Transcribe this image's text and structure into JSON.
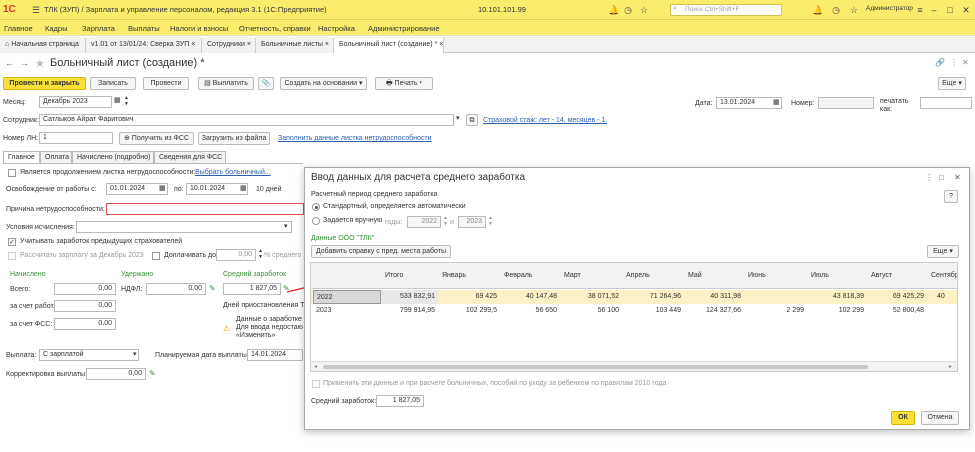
{
  "app": {
    "title": "ТЛК (ЗУП) / Зарплата и управление персоналом, редакция 3.1  (1С:Предприятие)",
    "ip": "10.101.101.99",
    "search_placeholder": "Поиск Ctrl+Shift+F",
    "user": "Администратор",
    "logo": "1С"
  },
  "menu": [
    "Главное",
    "Кадры",
    "Зарплата",
    "Выплаты",
    "Налоги и взносы",
    "Отчетность, справки",
    "Настройка",
    "Администрирование"
  ],
  "tabs": [
    "Начальная страница",
    "v1.01 от 13/01/24: Сверка ЗУП",
    "Сотрудники",
    "Больничные листы",
    "Больничный лист (создание) *"
  ],
  "doc": {
    "title": "Больничный лист (создание) *",
    "toolbar": {
      "post_close": "Провести и закрыть",
      "save": "Записать",
      "post": "Провести",
      "pay": "Выплатить",
      "create_based": "Создать на основании",
      "print": "Печать",
      "more": "Еще"
    },
    "month_label": "Месяц:",
    "month_value": "Декабрь 2023",
    "date_label": "Дата:",
    "date_value": "13.01.2024",
    "number_label": "Номер:",
    "number_value": "",
    "print_as_label": "печатать как:",
    "employee_label": "Сотрудник:",
    "employee_value": "Сатлыков Айрат Фаритович",
    "insurance_link": "Страховой стаж: лет - 14, месяцев - 1.",
    "ln_number_label": "Номер ЛН:",
    "ln_number_value": "1",
    "get_fss": "Получить из ФСС",
    "load_file": "Загрузить из файла",
    "fill_link": "Заполнить данные листка нетрудоспособности"
  },
  "form_tabs": [
    "Главное",
    "Оплата",
    "Начислено (подробно)",
    "Сведения для ФСС"
  ],
  "main": {
    "continuation_label": "Является продолжением листка нетрудоспособности:",
    "choose_link": "Выбрать больничный...",
    "release_from_label": "Освобождение от работы с:",
    "release_from": "01.01.2024",
    "release_to_label": "по:",
    "release_to": "10.01.2024",
    "days": "10 дней",
    "reason_label": "Причина нетрудоспособности:",
    "calc_conditions_label": "Условия исчисления:",
    "consider_prev_label": "Учитывать заработок предыдущих страхователей",
    "recalc_label": "Рассчитать зарплату за Декабрь 2023",
    "extra_label": "Доплачивать до",
    "extra_value": "0,00",
    "extra_pct": "% среднего з",
    "accrued_header": "Начислено",
    "withheld_header": "Удержано",
    "avg_header": "Средний заработок",
    "total_label": "Всего:",
    "total_value": "0,00",
    "ndfl_label": "НДФЛ:",
    "ndfl_value": "0,00",
    "avg_value": "1 827,05",
    "employer_label": "за счет работ.:",
    "employer_value": "0,00",
    "fss_label": "за счет ФСС:",
    "fss_value": "0,00",
    "suspension_label": "Дней приостановления ТД",
    "warn_line1": "Данные о заработке н",
    "warn_line2": "Для ввода недостаю",
    "warn_line3": "«Изменить»",
    "payout_label": "Выплата:",
    "payout_value": "С зарплатой",
    "planned_date_label": "Планируемая дата выплаты:",
    "planned_date": "14.01.2024",
    "correction_label": "Корректировка выплаты:",
    "correction_value": "0,00"
  },
  "dialog": {
    "title": "Ввод данных для расчета среднего заработка",
    "period_label": "Расчетный период среднего заработка",
    "radio_standard": "Стандартный, определяется автоматически",
    "radio_manual": "Задается вручную",
    "years_label": "годы:",
    "year_from": "2022",
    "and_label": "и",
    "year_to": "2023",
    "company_label": "Данные ООО \"ТЛК\"",
    "add_cert": "Добавить справку с пред. места работы",
    "more": "Еще",
    "help": "?",
    "columns": [
      "",
      "Итого",
      "Январь",
      "Февраль",
      "Март",
      "Апрель",
      "Май",
      "Июнь",
      "Июль",
      "Август",
      "Сентябрь"
    ],
    "rows": [
      {
        "year": "2022",
        "total": "533 832,91",
        "m": [
          "69 425",
          "40 147,48",
          "38 071,52",
          "71 264,96",
          "40 311,98",
          "",
          "43 818,39",
          "69 425,29",
          "40"
        ]
      },
      {
        "year": "2023",
        "total": "799 914,95",
        "m": [
          "102 299,5",
          "56 650",
          "56 100",
          "103 449",
          "124 327,66",
          "2 299",
          "102 299",
          "52 800,48",
          ""
        ]
      }
    ],
    "apply_label": "Применить эти данные и при расчете больничных, пособий по уходу за ребенком по правилам 2010 года",
    "avg_label": "Средний заработок:",
    "avg_value": "1 827,05",
    "ok": "ОК",
    "cancel": "Отмена"
  }
}
